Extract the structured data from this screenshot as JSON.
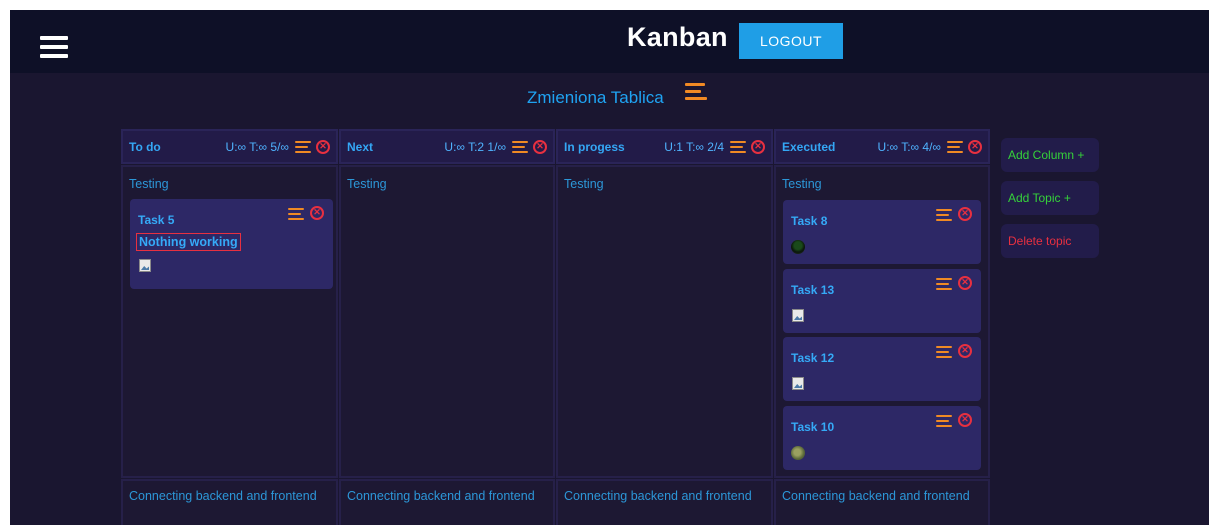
{
  "header": {
    "title": "Kanban",
    "logout_label": "LOGOUT",
    "menu_icon": "hamburger-icon"
  },
  "board": {
    "title": "Zmieniona Tablica",
    "menu_icon": "menu-icon"
  },
  "columns": [
    {
      "name": "To do",
      "limits": "U:∞ T:∞ 5/∞"
    },
    {
      "name": "Next",
      "limits": "U:∞ T:2 1/∞"
    },
    {
      "name": "In progess",
      "limits": "U:1 T:∞ 2/4"
    },
    {
      "name": "Executed",
      "limits": "U:∞ T:∞ 4/∞"
    }
  ],
  "topics": [
    {
      "name": "Testing"
    },
    {
      "name": "Connecting backend and frontend"
    }
  ],
  "tasks": {
    "todo": [
      {
        "title": "Task 5",
        "description": "Nothing working"
      }
    ],
    "executed": [
      {
        "title": "Task 8",
        "image": "avatar-dark"
      },
      {
        "title": "Task 13",
        "image": "broken-image"
      },
      {
        "title": "Task 12",
        "image": "broken-image"
      },
      {
        "title": "Task 10",
        "image": "avatar-olive"
      }
    ]
  },
  "side_buttons": {
    "add_column": "Add Column +",
    "add_topic": "Add Topic +",
    "delete_topic": "Delete topic"
  },
  "colors": {
    "background": "#1a1630",
    "topbar": "#0e1027",
    "accent_blue": "#1f9ee6",
    "menu_orange": "#f08a24",
    "close_red": "#e83040",
    "add_green": "#35d23a"
  }
}
